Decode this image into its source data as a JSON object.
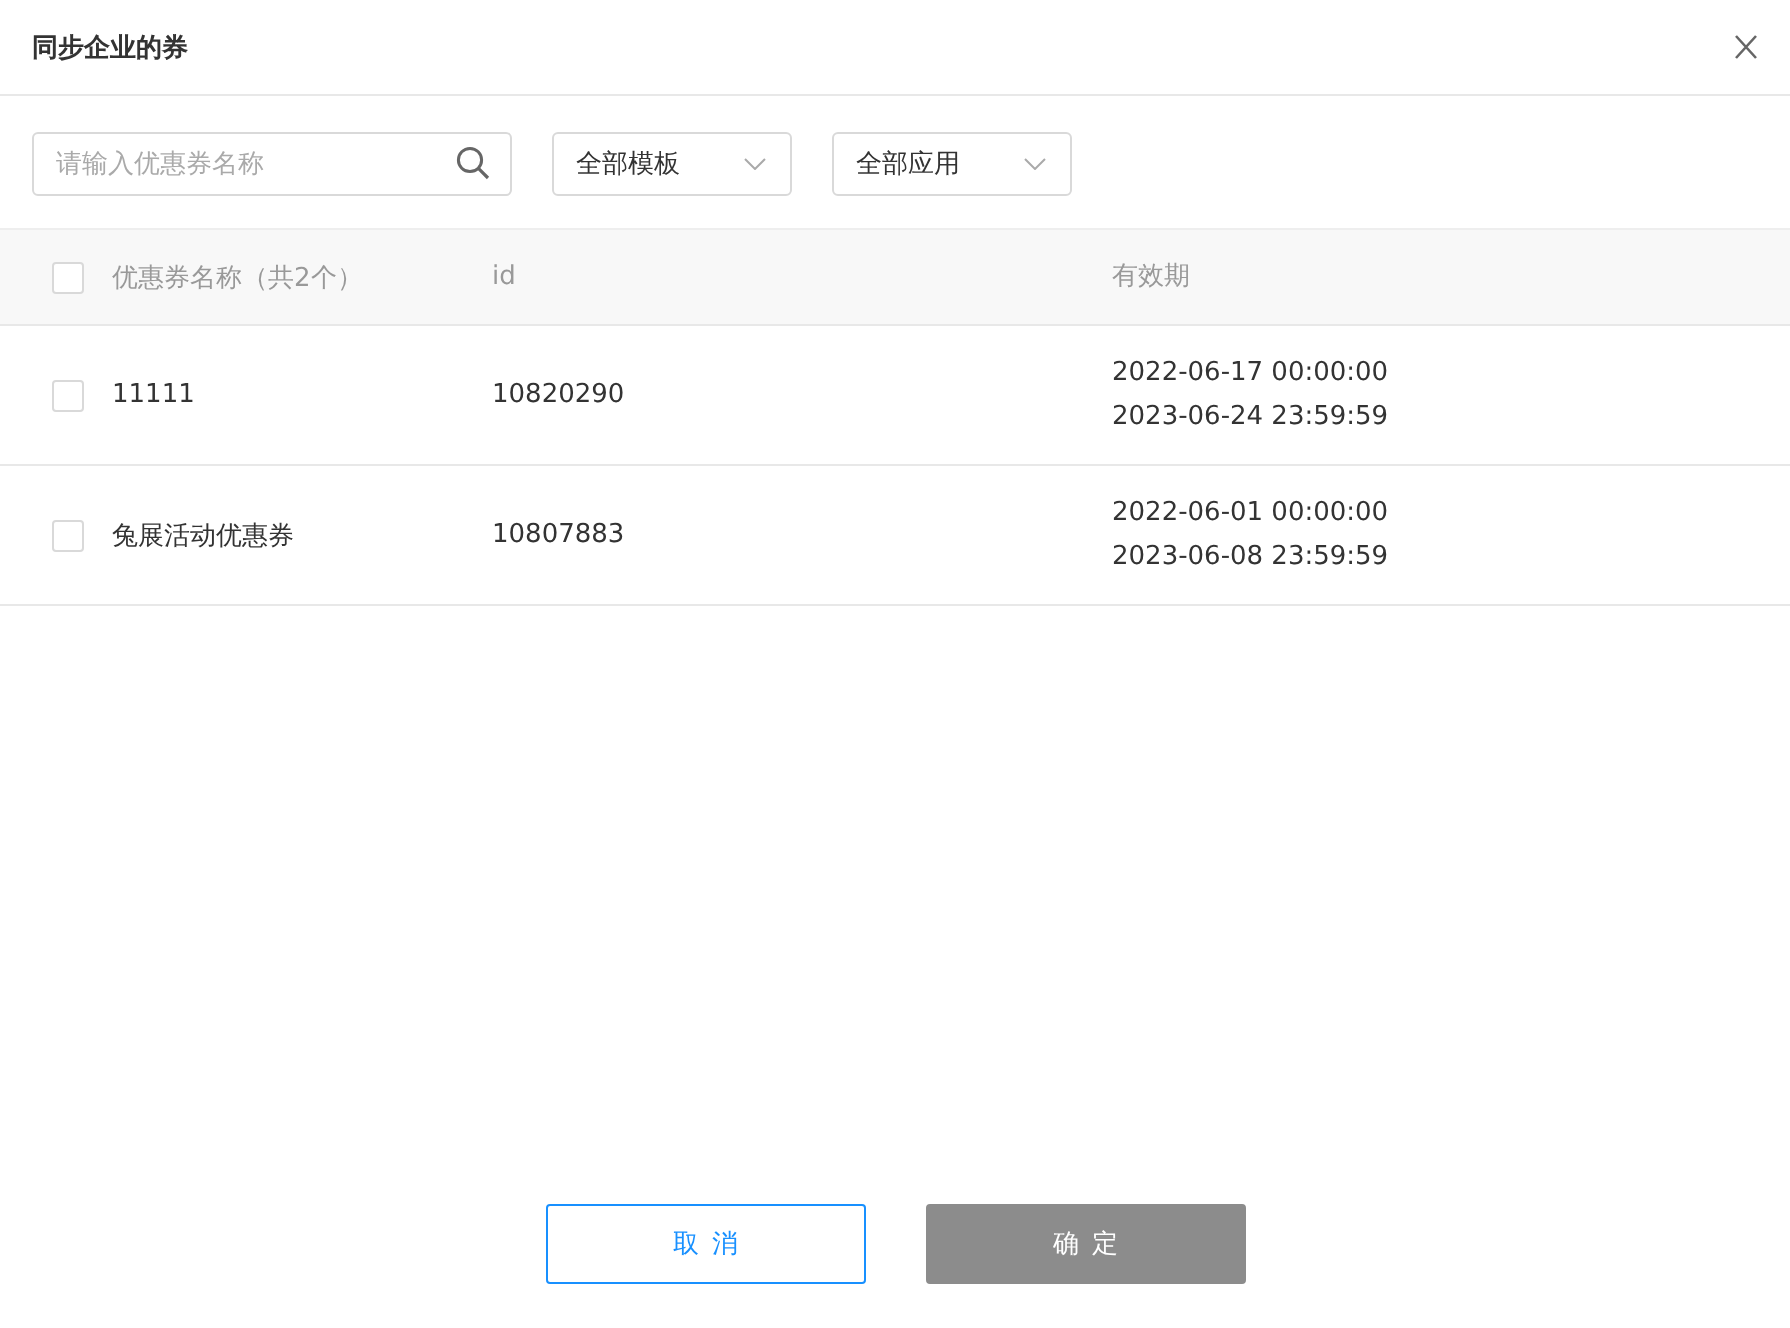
{
  "dialog": {
    "title": "同步企业的券"
  },
  "filters": {
    "search": {
      "placeholder": "请输入优惠券名称"
    },
    "dropdowns": [
      {
        "value": "全部模板"
      },
      {
        "value": "全部应用"
      }
    ]
  },
  "table": {
    "select_all_checked": false,
    "columns": [
      "优惠券名称（共2个）",
      "id",
      "有效期"
    ],
    "rows": [
      {
        "checked": false,
        "name": "11111",
        "id": "10820290",
        "validity": [
          "2022-06-17 00:00:00",
          "2023-06-24 23:59:59"
        ]
      },
      {
        "checked": false,
        "name": "兔展活动优惠券",
        "id": "10807883",
        "validity": [
          "2022-06-01 00:00:00",
          "2023-06-08 23:59:59"
        ]
      }
    ]
  },
  "buttons": [
    {
      "label": "取消",
      "kind": "secondary",
      "disabled": false
    },
    {
      "label": "确定",
      "kind": "primary",
      "disabled": true
    }
  ]
}
